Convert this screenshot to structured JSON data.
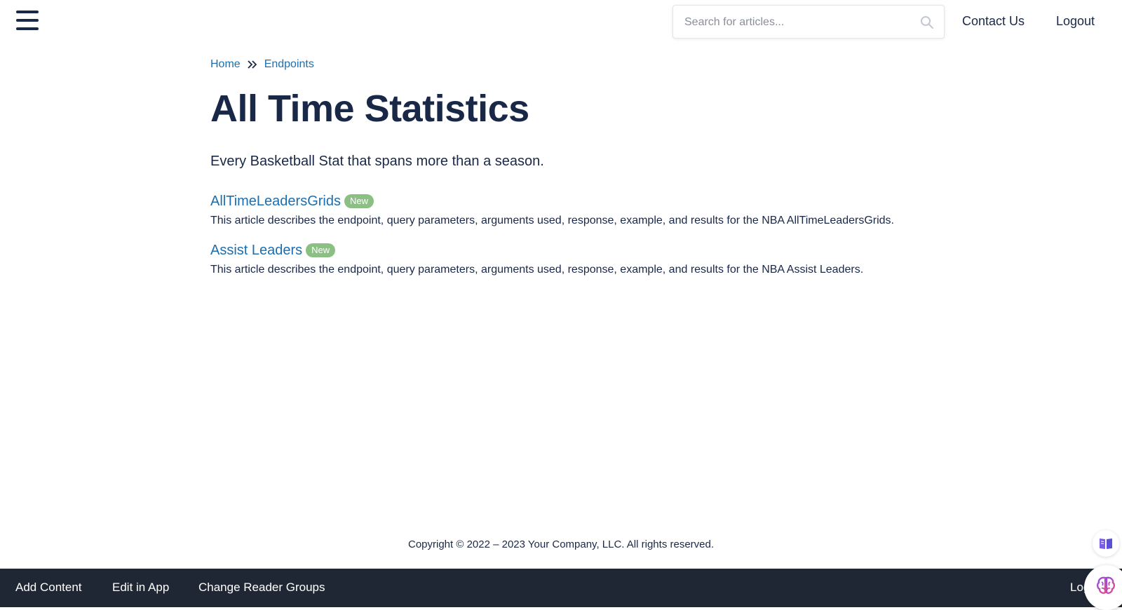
{
  "header": {
    "search": {
      "placeholder": "Search for articles...",
      "value": ""
    },
    "nav": [
      {
        "label": "Contact Us"
      },
      {
        "label": "Logout"
      }
    ]
  },
  "breadcrumb": [
    {
      "label": "Home"
    },
    {
      "label": "Endpoints"
    }
  ],
  "page": {
    "title": "All Time Statistics",
    "description": "Every Basketball Stat that spans more than a season."
  },
  "articles": [
    {
      "title": "AllTimeLeadersGrids",
      "badge": "New",
      "description": "This article describes the endpoint, query parameters, arguments used, response, example, and results for the NBA AllTimeLeadersGrids."
    },
    {
      "title": "Assist Leaders",
      "badge": "New",
      "description": "This article describes the endpoint, query parameters, arguments used, response, example, and results for the NBA Assist Leaders."
    }
  ],
  "footer": {
    "copyright": "Copyright © 2022 – 2023 Your Company, LLC. All rights reserved."
  },
  "bottom_bar": {
    "items": [
      {
        "label": "Add Content"
      },
      {
        "label": "Edit in App"
      },
      {
        "label": "Change Reader Groups"
      }
    ],
    "right_label": "Log"
  },
  "colors": {
    "primary": "#1a2847",
    "link": "#1b6fb0",
    "badge": "#8cbf84",
    "bottom_bar": "#1e2733"
  },
  "icons": {
    "menu": "hamburger-menu-icon",
    "search": "search-icon",
    "breadcrumb_separator": "double-chevron-right-icon",
    "reader": "book-icon",
    "assistant": "brain-icon"
  }
}
